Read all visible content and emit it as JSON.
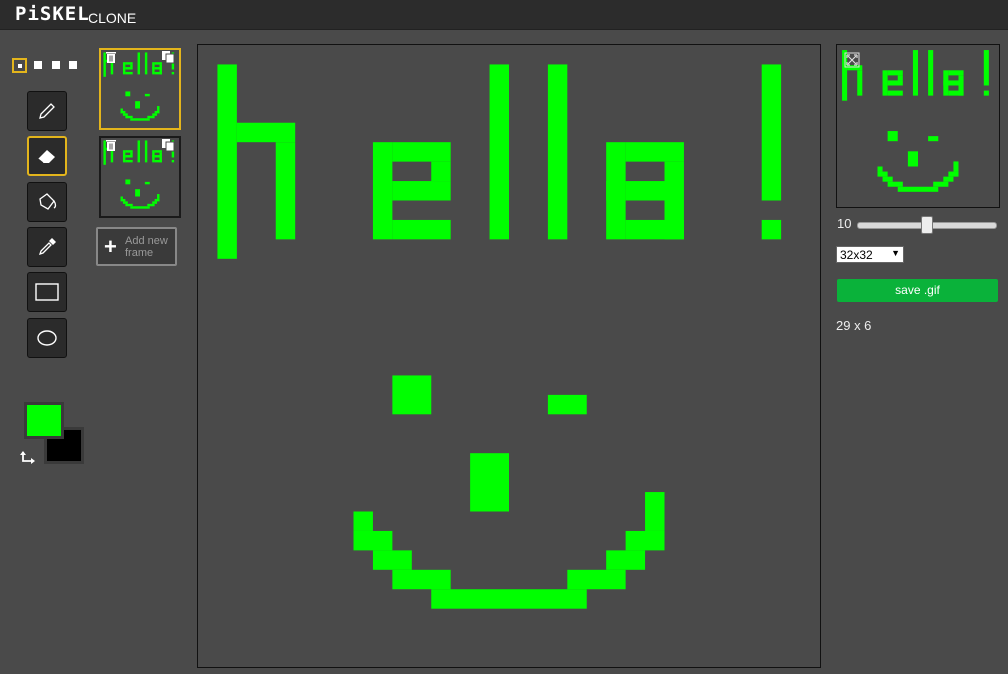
{
  "header": {
    "logo": "PiSKEL",
    "subtitle": "CLONE"
  },
  "pen_sizes": [
    "1",
    "2",
    "3",
    "4"
  ],
  "tools": [
    {
      "name": "pencil-icon",
      "selected": false
    },
    {
      "name": "eraser-icon",
      "selected": true
    },
    {
      "name": "paint-bucket-icon",
      "selected": false
    },
    {
      "name": "eyedropper-icon",
      "selected": false
    },
    {
      "name": "rectangle-icon",
      "selected": false
    },
    {
      "name": "ellipse-icon",
      "selected": false
    }
  ],
  "colors": {
    "primary": "#00ff00",
    "secondary": "#000000",
    "accent": "#e3b51c",
    "save": "#0ab23a"
  },
  "frames": [
    {
      "selected": true
    },
    {
      "selected": false
    }
  ],
  "add_frame": {
    "line1": "Add new",
    "line2": "frame"
  },
  "fps": {
    "value": "10",
    "level": 0.5
  },
  "size_select": {
    "value": "32x32"
  },
  "save_button": {
    "label": "save .gif"
  },
  "dimensions": "29 x 6"
}
